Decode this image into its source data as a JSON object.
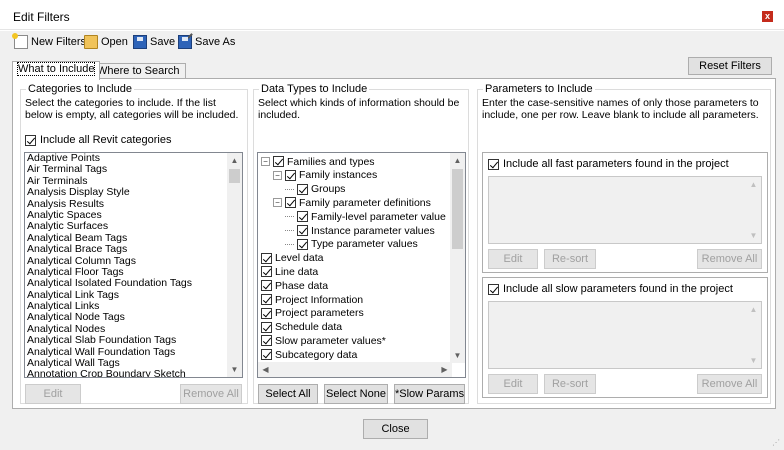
{
  "window": {
    "title": "Edit Filters",
    "close_glyph": "x"
  },
  "toolbar": {
    "new_label": "New Filters",
    "open_label": "Open",
    "save_label": "Save",
    "saveas_label": "Save As"
  },
  "tabs": [
    {
      "label": "What to Include",
      "active": true
    },
    {
      "label": "Where to Search",
      "active": false
    }
  ],
  "reset_label": "Reset Filters",
  "categories": {
    "title": "Categories to Include",
    "description": "Select the categories to include.   If the list below is empty, all categories will be included.",
    "include_all_label": "Include all Revit categories",
    "include_all_checked": true,
    "items": [
      "Adaptive Points",
      "Air Terminal Tags",
      "Air Terminals",
      "Analysis Display Style",
      "Analysis Results",
      "Analytic Spaces",
      "Analytic Surfaces",
      "Analytical Beam Tags",
      "Analytical Brace Tags",
      "Analytical Column Tags",
      "Analytical Floor Tags",
      "Analytical Isolated Foundation Tags",
      "Analytical Link Tags",
      "Analytical Links",
      "Analytical Node Tags",
      "Analytical Nodes",
      "Analytical Slab Foundation Tags",
      "Analytical Wall Foundation Tags",
      "Analytical Wall Tags",
      "Annotation Crop Boundary Sketch"
    ],
    "edit_label": "Edit",
    "remove_all_label": "Remove All"
  },
  "datatypes": {
    "title": "Data Types to Include",
    "description": "Select which kinds of information should be included.",
    "tree": [
      {
        "label": "Families and types",
        "level": 0,
        "expander": "−",
        "checked": true
      },
      {
        "label": "Family instances",
        "level": 1,
        "expander": "−",
        "checked": true
      },
      {
        "label": "Groups",
        "level": 2,
        "expander": "",
        "checked": true
      },
      {
        "label": "Family parameter definitions",
        "level": 1,
        "expander": "−",
        "checked": true
      },
      {
        "label": "Family-level parameter value",
        "level": 2,
        "expander": "",
        "checked": true
      },
      {
        "label": "Instance parameter values",
        "level": 2,
        "expander": "",
        "checked": true
      },
      {
        "label": "Type parameter values",
        "level": 2,
        "expander": "",
        "checked": true
      },
      {
        "label": "Level data",
        "level": 0,
        "expander": "",
        "checked": true
      },
      {
        "label": "Line data",
        "level": 0,
        "expander": "",
        "checked": true
      },
      {
        "label": "Phase data",
        "level": 0,
        "expander": "",
        "checked": true
      },
      {
        "label": "Project Information",
        "level": 0,
        "expander": "",
        "checked": true
      },
      {
        "label": "Project parameters",
        "level": 0,
        "expander": "",
        "checked": true
      },
      {
        "label": "Schedule data",
        "level": 0,
        "expander": "",
        "checked": true
      },
      {
        "label": "Slow parameter values*",
        "level": 0,
        "expander": "",
        "checked": true
      },
      {
        "label": "Subcategory data",
        "level": 0,
        "expander": "",
        "checked": true
      }
    ],
    "select_all_label": "Select All",
    "select_none_label": "Select None",
    "slow_params_label": "*Slow Params"
  },
  "parameters": {
    "title": "Parameters to Include",
    "description": "Enter the case-sensitive names of only those parameters to include, one per row.  Leave blank to include all parameters.",
    "fast": {
      "label": "Include all fast parameters found in the project",
      "checked": true,
      "edit_label": "Edit",
      "resort_label": "Re-sort",
      "remove_all_label": "Remove All"
    },
    "slow": {
      "label": "Include all slow parameters found in the project",
      "checked": true,
      "edit_label": "Edit",
      "resort_label": "Re-sort",
      "remove_all_label": "Remove All"
    }
  },
  "close_label": "Close",
  "icons": {
    "new": "new-file-icon",
    "open": "open-folder-icon",
    "save": "save-disk-icon",
    "saveas": "save-as-icon"
  }
}
